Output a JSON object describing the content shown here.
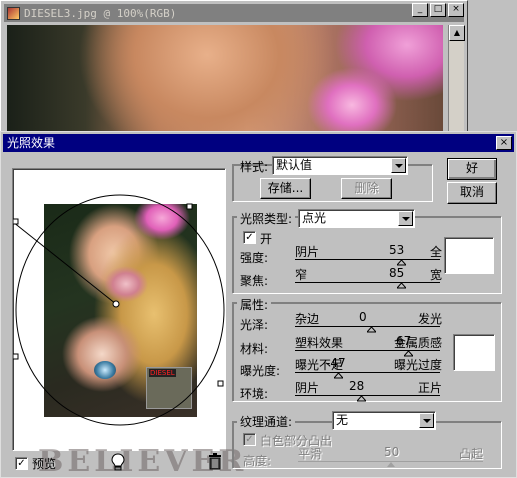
{
  "doc_window": {
    "title": "DIESEL3.jpg @ 100%(RGB)",
    "minimize": "_",
    "maximize": "□",
    "close": "×"
  },
  "dialog": {
    "title": "光照效果",
    "close": "×",
    "style": {
      "label": "样式:",
      "value": "默认值",
      "save": "存储...",
      "delete": "删除"
    },
    "buttons": {
      "ok": "好",
      "cancel": "取消"
    },
    "light": {
      "label": "光照类型:",
      "type": "点光",
      "on_label": "开",
      "on_checked": true,
      "color": "#ffffff",
      "sliders": [
        {
          "name": "intensity",
          "label": "强度:",
          "left": "阴片",
          "value": "53",
          "right": "全"
        },
        {
          "name": "focus",
          "label": "聚焦:",
          "left": "窄",
          "value": "85",
          "right": "宽"
        }
      ]
    },
    "properties": {
      "label": "属性:",
      "color": "#ffffff",
      "sliders": [
        {
          "name": "gloss",
          "label": "光泽:",
          "left": "杂边",
          "value": "0",
          "right": "发光"
        },
        {
          "name": "material",
          "label": "材料:",
          "left": "塑料效果",
          "value": "67",
          "right": "金属质感"
        },
        {
          "name": "exposure",
          "label": "曝光度:",
          "left": "曝光不足",
          "value": "-47",
          "right": "曝光过度"
        },
        {
          "name": "ambience",
          "label": "环境:",
          "left": "阴片",
          "value": "28",
          "right": "正片"
        }
      ]
    },
    "texture": {
      "label": "纹理通道:",
      "value": "无",
      "white_high_label": "白色部分凸出",
      "height_label": "高度:",
      "height_left": "平滑",
      "height_value": "50",
      "height_right": "凸起"
    },
    "preview": {
      "checkbox_label": "预览",
      "checked": true,
      "watermark": "BELIEVER",
      "badge_text": "DIESEL",
      "icons": [
        "light-bulb-icon",
        "trash-icon"
      ]
    }
  }
}
